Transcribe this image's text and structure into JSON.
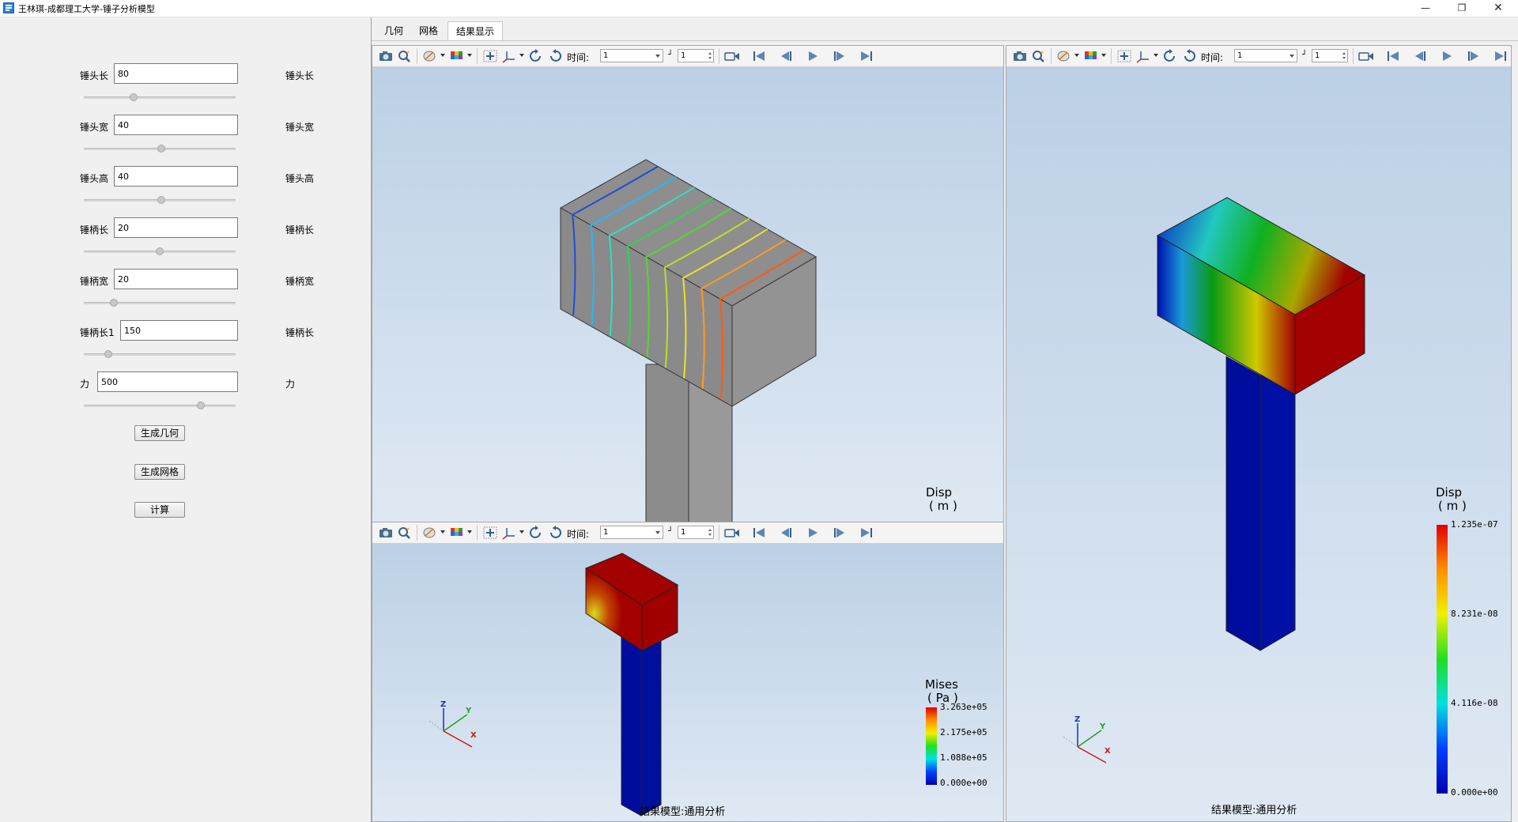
{
  "window": {
    "title": "王林琪-成都理工大学-锤子分析模型",
    "minimize_icon": "minimize-icon",
    "restore_icon": "restore-icon",
    "close_icon": "close-icon"
  },
  "params": [
    {
      "label": "锤头长",
      "value": "80",
      "unit_label": "锤头长",
      "slider": 0.33
    },
    {
      "label": "锤头宽",
      "value": "40",
      "unit_label": "锤头宽",
      "slider": 0.51
    },
    {
      "label": "锤头高",
      "value": "40",
      "unit_label": "锤头高",
      "slider": 0.51
    },
    {
      "label": "锤柄长",
      "value": "20",
      "unit_label": "锤柄长",
      "slider": 0.5
    },
    {
      "label": "锤柄宽",
      "value": "20",
      "unit_label": "锤柄宽",
      "slider": 0.2
    },
    {
      "label": "锤柄长1",
      "value": "150",
      "unit_label": "锤柄长",
      "slider": 0.16
    },
    {
      "label": "力",
      "value": "500",
      "unit_label": "力",
      "slider": 0.77
    }
  ],
  "buttons": {
    "gen_geometry": "生成几何",
    "gen_mesh": "生成网格",
    "compute": "计算"
  },
  "tabs": [
    {
      "label": "几何",
      "active": false
    },
    {
      "label": "网格",
      "active": false
    },
    {
      "label": "结果显示",
      "active": true
    }
  ],
  "toolbar": {
    "time_label": "时间:",
    "time_value": "1",
    "step_value": "1",
    "icons": [
      "camera-icon",
      "zoom-fit-icon",
      "display-mode-icon",
      "color-map-icon",
      "pan-icon",
      "axes-icon",
      "rotate-left-icon",
      "rotate-right-icon",
      "record-icon",
      "first-frame-icon",
      "prev-frame-icon",
      "play-icon",
      "next-frame-icon",
      "last-frame-icon"
    ]
  },
  "viewports": {
    "top_left": {
      "legend_title": "Disp",
      "legend_unit": "( m )",
      "legend_partial": "1.235e-07",
      "contour_colors": [
        "#1d4fd6",
        "#22b8ff",
        "#2fe0c8",
        "#2bd84a",
        "#55d633",
        "#b8e02a",
        "#f0e02a",
        "#ff9b1f",
        "#ff5a10"
      ]
    },
    "bottom_left": {
      "footer": "结果模型:通用分析",
      "legend_title": "Mises",
      "legend_unit": "( Pa )",
      "legend_ticks": [
        "3.263e+05",
        "2.175e+05",
        "1.088e+05",
        "0.000e+00"
      ],
      "axis_labels": {
        "z": "Z",
        "y": "Y",
        "x": "X"
      }
    },
    "right": {
      "footer": "结果模型:通用分析",
      "legend_title": "Disp",
      "legend_unit": "( m )",
      "legend_ticks": [
        "1.235e-07",
        "8.231e-08",
        "4.116e-08",
        "0.000e+00"
      ],
      "axis_labels": {
        "z": "Z",
        "y": "Y",
        "x": "X"
      }
    }
  },
  "colors": {
    "scene_top": "#bcd0e6",
    "scene_bottom": "#dfe9f3",
    "model_gray": "#8c8c8c",
    "field_blue": "#000c9e",
    "field_red": "#a30000"
  }
}
